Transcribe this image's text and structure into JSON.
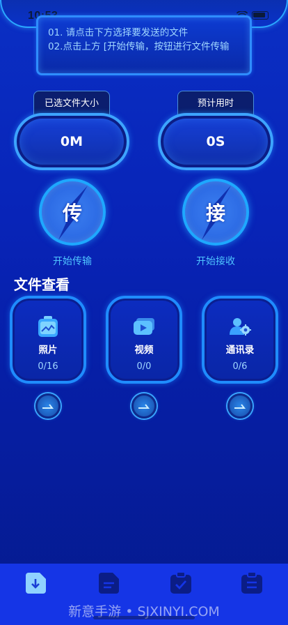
{
  "status_bar": {
    "time": "10:53"
  },
  "notice": {
    "line1": "01. 请点击下方选择要发送的文件",
    "line2": "02.点击上方 [开始传输，按钮进行文件传输"
  },
  "stats": {
    "size": {
      "label": "已选文件大小",
      "value": "0M"
    },
    "time": {
      "label": "预计用时",
      "value": "0S"
    }
  },
  "actions": {
    "send": {
      "glyph": "传",
      "label": "开始传输"
    },
    "receive": {
      "glyph": "接",
      "label": "开始接收"
    }
  },
  "section_title": "文件查看",
  "files": [
    {
      "name": "照片",
      "count": "0/16",
      "icon": "photo-icon"
    },
    {
      "name": "视频",
      "count": "0/0",
      "icon": "video-icon"
    },
    {
      "name": "通讯录",
      "count": "0/6",
      "icon": "contacts-icon"
    }
  ],
  "tabs": [
    {
      "icon": "download-doc-icon",
      "active": true
    },
    {
      "icon": "document-icon",
      "active": false
    },
    {
      "icon": "clipboard-check-icon",
      "active": false
    },
    {
      "icon": "clipboard-list-icon",
      "active": false
    }
  ],
  "watermark": "新意手游 • SJXINYI.COM",
  "colors": {
    "background": "#0824b8",
    "accent": "#1f8cff",
    "label_cyan": "#4fc4ff",
    "tab_bar": "#1535e6"
  }
}
